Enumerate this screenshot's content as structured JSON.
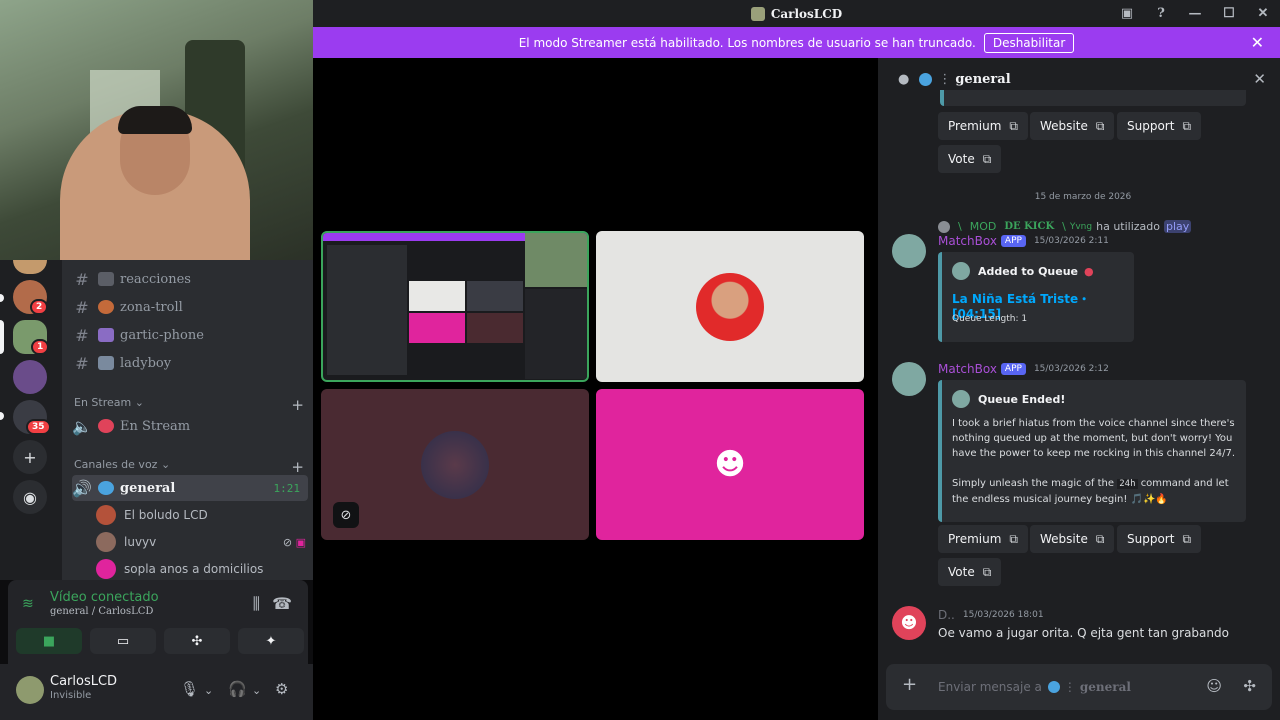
{
  "window": {
    "title": "CarlosLCD",
    "controls": [
      "▣",
      "?",
      "—",
      "☐",
      "✕"
    ]
  },
  "banner": {
    "text": "El modo Streamer está habilitado. Los nombres de usuario se han truncado.",
    "button": "Deshabilitar",
    "close": "✕"
  },
  "servers": [
    {
      "badge": "2"
    },
    {
      "badge": "1"
    },
    {
      "badge": ""
    },
    {
      "badge": "35"
    }
  ],
  "channels": [
    {
      "name": "reacciones"
    },
    {
      "name": "zona-troll"
    },
    {
      "name": "gartic-phone"
    },
    {
      "name": "ladyboy"
    }
  ],
  "categories": {
    "stream": "En Stream",
    "voice": "Canales de voz"
  },
  "stream_channel": {
    "name": "En Stream"
  },
  "voice_channel": {
    "name": "general",
    "time": "1:21"
  },
  "voice_users": [
    {
      "name": "El boludo LCD"
    },
    {
      "name": "luvyv"
    },
    {
      "name": "sopla anos a domicilios"
    }
  ],
  "voice_panel": {
    "title": "Vídeo conectado",
    "sub": "general / CarlosLCD"
  },
  "user": {
    "name": "CarlosLCD",
    "status": "Invisible"
  },
  "chat": {
    "channel": "general",
    "links_top": [
      "Premium",
      "Website",
      "Support",
      "Vote"
    ],
    "date_divider": "15 de marzo de 2026",
    "reply": {
      "pre": "\\",
      "mod": "MOD",
      "kick": "DE KICK",
      "yvng": "Yvng",
      "action": "ha utilizado",
      "command": "play"
    },
    "msg1": {
      "author": "MatchBox",
      "app": "APP",
      "time": "15/03/2026 2:11",
      "embed_title": "Added to Queue",
      "song": "La Niña Está Triste・[04:15]",
      "queue": "Queue Length: 1"
    },
    "msg2": {
      "author": "MatchBox",
      "app": "APP",
      "time": "15/03/2026 2:12",
      "embed_title": "Queue Ended!",
      "p1": "I took a brief hiatus from the voice channel since there's nothing queued up at the moment, but don't worry! You have the power to keep me rocking in this channel 24/7.",
      "p2a": "Simply unleash the magic of the",
      "p2cmd": "24h",
      "p2b": "command and let the endless musical journey begin! 🎵✨🔥"
    },
    "links_bottom": [
      "Premium",
      "Website",
      "Support",
      "Vote"
    ],
    "msg3": {
      "author": "D..",
      "time": "15/03/2026 18:01",
      "text": "Oe vamo a jugar orita. Q ejta gent tan grabando"
    },
    "input_placeholder": "Enviar mensaje a",
    "input_channel": "general"
  },
  "colors": {
    "accent": "#9b3cf0",
    "voice_green": "#3ba55c",
    "app_badge": "#5865f2",
    "discord_pink": "#e0249d"
  }
}
